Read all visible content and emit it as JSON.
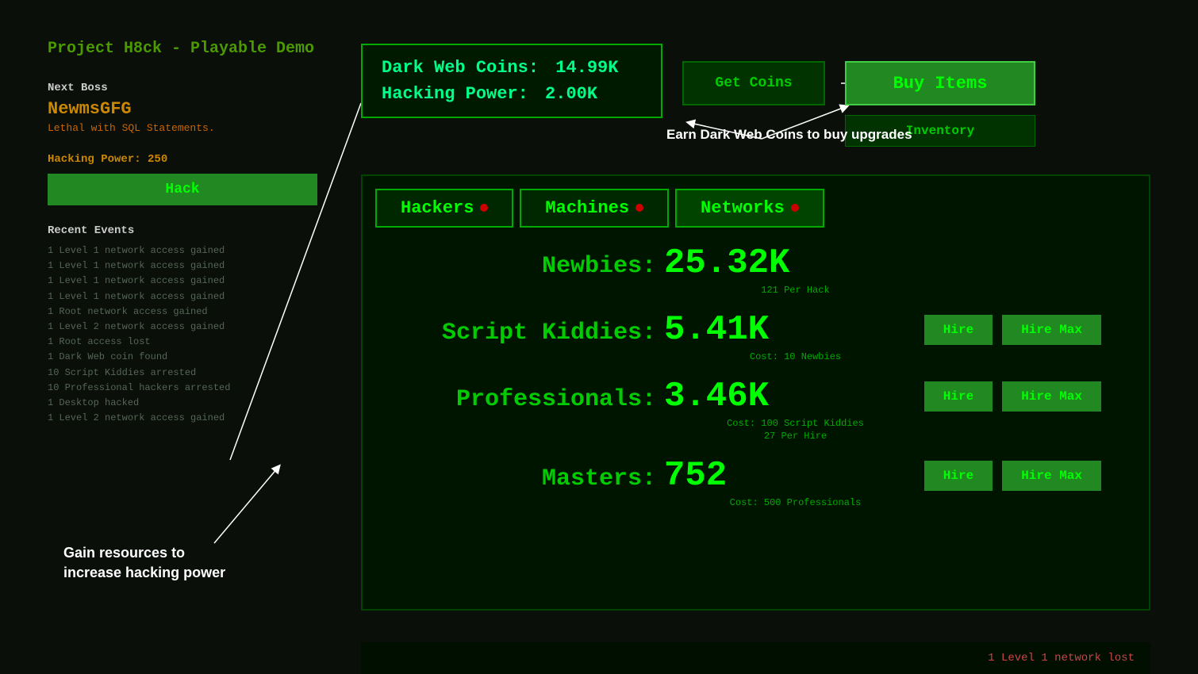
{
  "sidebar": {
    "title": "Project H8ck - Playable Demo",
    "next_boss_label": "Next Boss",
    "boss_name": "NewmsGFG",
    "boss_desc": "Lethal with SQL Statements.",
    "hacking_power_label": "Hacking Power: 250",
    "hack_button": "Hack",
    "recent_events_label": "Recent Events",
    "events": [
      "1 Level 1 network access gained",
      "1 Level 1 network access gained",
      "1 Level 1 network access gained",
      "1 Level 1 network access gained",
      "1 Root network access gained",
      "1 Level 2 network access gained",
      "1 Root access lost",
      "1 Dark Web coin found",
      "10 Script Kiddies arrested",
      "10 Professional hackers arrested",
      "1 Desktop hacked",
      "1 Level 2 network access gained"
    ]
  },
  "currency": {
    "coins_label": "Dark Web Coins:",
    "coins_value": "14.99K",
    "power_label": "Hacking Power:",
    "power_value": "2.00K"
  },
  "buttons": {
    "get_coins": "Get Coins",
    "buy_items": "Buy Items",
    "inventory": "Inventory"
  },
  "tabs": [
    {
      "label": "Hackers",
      "has_dot": true
    },
    {
      "label": "Machines",
      "has_dot": true
    },
    {
      "label": "Networks",
      "has_dot": true
    }
  ],
  "hackers": [
    {
      "name": "Newbies:",
      "count": "25.32K",
      "sub": "121 Per Hack",
      "has_hire": false
    },
    {
      "name": "Script Kiddies:",
      "count": "5.41K",
      "sub": "Cost: 10 Newbies",
      "has_hire": true
    },
    {
      "name": "Professionals:",
      "count": "3.46K",
      "sub1": "Cost: 100 Script Kiddies",
      "sub2": "27 Per Hire",
      "has_hire": true
    },
    {
      "name": "Masters:",
      "count": "752",
      "sub": "Cost: 500 Professionals",
      "has_hire": true
    }
  ],
  "hire_buttons": {
    "hire": "Hire",
    "hire_max": "Hire Max"
  },
  "annotations": {
    "coins": "Earn Dark Web Coins to buy upgrades",
    "resources": "Gain resources to\nincrease hacking power"
  },
  "status": {
    "text": "1 Level 1 network lost"
  }
}
